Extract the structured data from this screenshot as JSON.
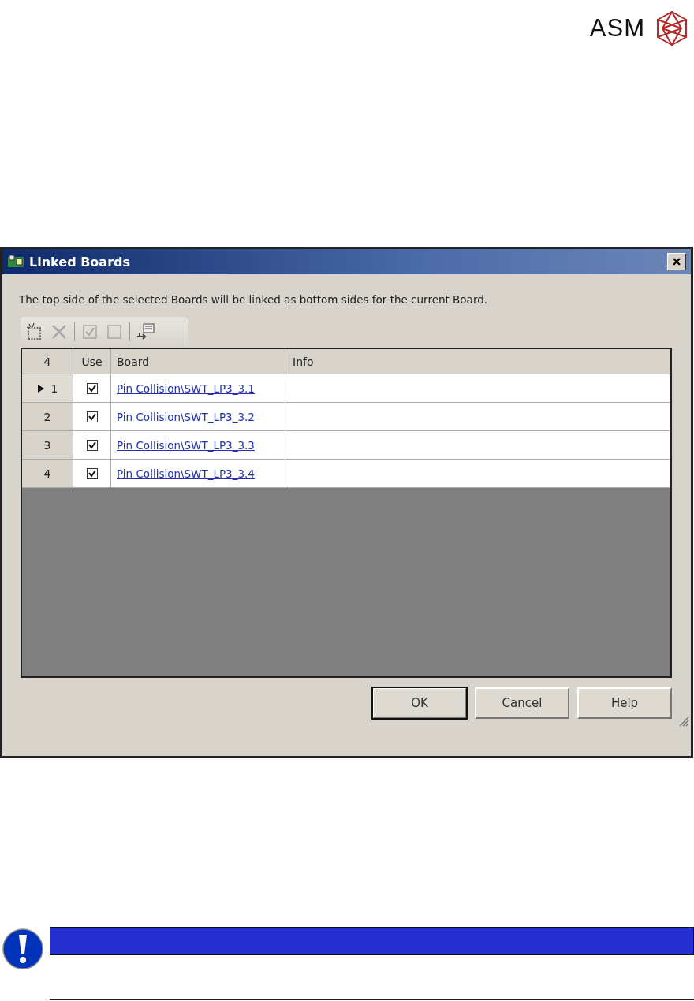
{
  "logo": {
    "text": "ASM"
  },
  "dialog": {
    "title": "Linked Boards",
    "message": "The top side of the selected Boards will be linked as bottom sides for the current Board.",
    "toolbar": [
      {
        "kind": "add",
        "disabled": false
      },
      {
        "kind": "delete",
        "disabled": true
      },
      {
        "kind": "separator"
      },
      {
        "kind": "check-all",
        "disabled": true
      },
      {
        "kind": "uncheck-all",
        "disabled": true
      },
      {
        "kind": "separator"
      },
      {
        "kind": "link",
        "disabled": false
      }
    ],
    "table": {
      "columns": [
        "4",
        "Use",
        "Board",
        "Info"
      ],
      "rows": [
        {
          "number": "1",
          "current": true,
          "use": true,
          "board": "Pin Collision\\SWT_LP3_3.1"
        },
        {
          "number": "2",
          "current": false,
          "use": true,
          "board": "Pin Collision\\SWT_LP3_3.2"
        },
        {
          "number": "3",
          "current": false,
          "use": true,
          "board": "Pin Collision\\SWT_LP3_3.3"
        },
        {
          "number": "4",
          "current": false,
          "use": true,
          "board": "Pin Collision\\SWT_LP3_3.4"
        }
      ]
    },
    "buttons": [
      {
        "label": "OK",
        "default": true
      },
      {
        "label": "Cancel",
        "default": false
      },
      {
        "label": "Help",
        "default": false
      }
    ]
  },
  "notice": {
    "kind": "important"
  }
}
